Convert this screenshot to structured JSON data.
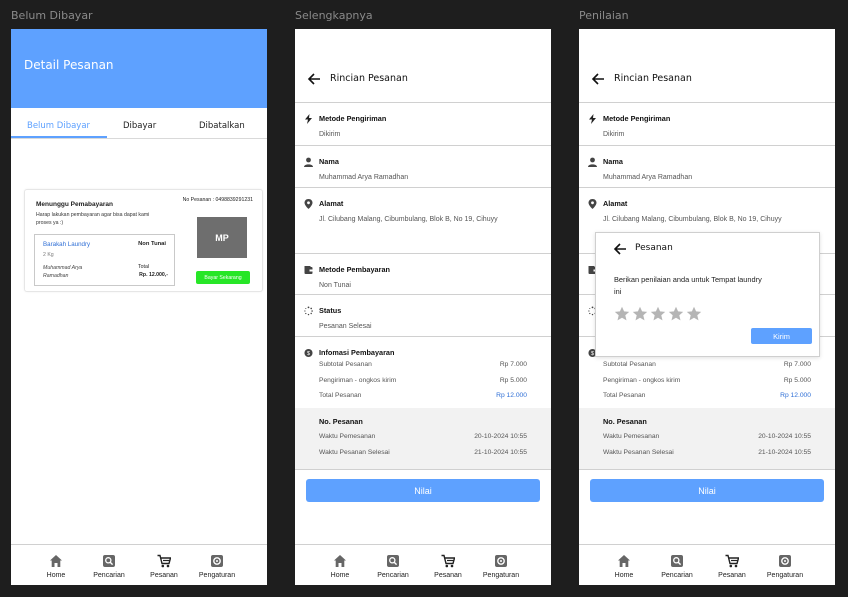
{
  "frames": {
    "f1": "Belum Dibayar",
    "f2": "Selengkapnya",
    "f3": "Penilaian"
  },
  "colors": {
    "primary": "#5ea1ff",
    "pay_green": "#27e627",
    "link_blue": "#2f6fd6"
  },
  "f1": {
    "title": "Detail Pesanan",
    "tabs": [
      "Belum Dibayar",
      "Dibayar",
      "Dibatalkan"
    ],
    "card": {
      "status": "Menunggu Pemabayaran",
      "order_no": "No Pesanan : 0498839291231",
      "desc": "Harap lakukan pembayaran agar bisa dapat kami proses ya :)",
      "laundry": "Barakah  Laundry",
      "payment": "Non Tunai",
      "weight": "2 Kg",
      "customer": "Muhammad Arya Ramadhan",
      "total_label": "Total",
      "total_value": "Rp. 12.000,-",
      "thumb": "MP",
      "pay_button": "Bayar Sekarang"
    }
  },
  "detail": {
    "title": "Rincian Pesanan",
    "metode_pengiriman": {
      "label": "Metode Pengiriman",
      "value": "Dikirim"
    },
    "nama": {
      "label": "Nama",
      "value": "Muhammad Arya Ramadhan"
    },
    "alamat": {
      "label": "Alamat",
      "value": "Jl. Cilubang Malang, Cibumbulang, Blok B, No 19, Cihuyy"
    },
    "metode_pembayaran": {
      "label": "Metode Pembayaran",
      "value": "Non Tunai"
    },
    "status": {
      "label": "Status",
      "value": "Pesanan Selesai"
    },
    "info": {
      "label": "Infomasi Pembayaran",
      "subtotal_label": "Subtotal Pesanan",
      "subtotal_value": "Rp 7.000",
      "ongkir_label": "Pengiriman - ongkos kirim",
      "ongkir_value": "Rp 5.000",
      "total_label": "Total Pesanan",
      "total_value": "Rp 12.000"
    },
    "pesanan": {
      "label": "No. Pesanan",
      "waktu_label": "Waktu Pemesanan",
      "waktu_value": "20-10-2024 10:55",
      "selesai_label": "Waktu Pesanan Selesai",
      "selesai_value": "21-10-2024 10:55"
    },
    "nilai_button": "Nilai"
  },
  "modal": {
    "title": "Pesanan",
    "prompt": "Berikan penilaian anda untuk Tempat laundry ini",
    "rating": 0,
    "max_rating": 5,
    "submit": "Kirim"
  },
  "nav": [
    {
      "label": "Home",
      "icon": "home-icon"
    },
    {
      "label": "Pencarian",
      "icon": "search-icon"
    },
    {
      "label": "Pesanan",
      "icon": "cart-icon"
    },
    {
      "label": "Pengaturan",
      "icon": "gear-icon"
    }
  ]
}
